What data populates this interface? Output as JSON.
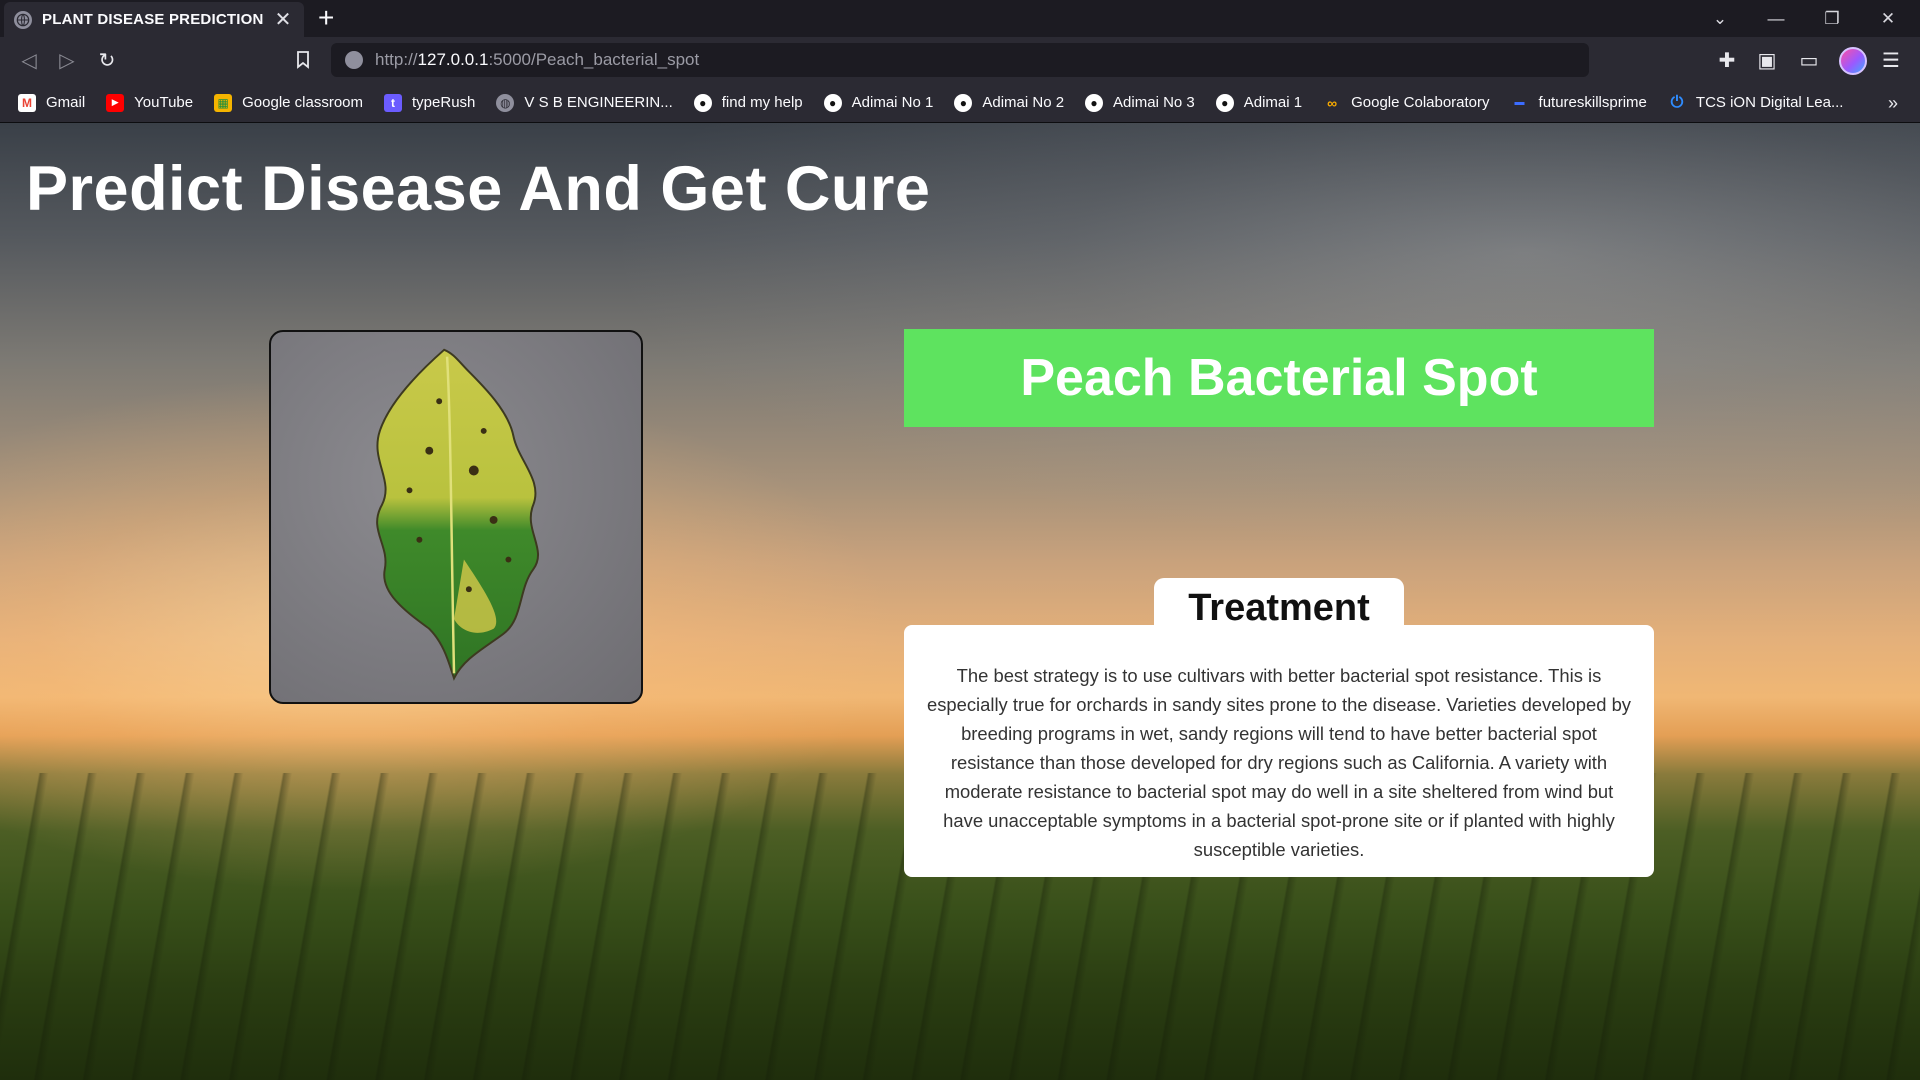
{
  "browser": {
    "tab_title": "PLANT DISEASE PREDICTION",
    "tab_close": "✕",
    "new_tab": "+",
    "url_scheme": "http://",
    "url_host": "127.0.0.1",
    "url_rest": ":5000/Peach_bacterial_spot",
    "bookmarks": [
      {
        "label": "Gmail",
        "icon": "gmail-icon"
      },
      {
        "label": "YouTube",
        "icon": "youtube-icon"
      },
      {
        "label": "Google classroom",
        "icon": "classroom-icon"
      },
      {
        "label": "typeRush",
        "icon": "typerush-icon"
      },
      {
        "label": "V S B ENGINEERIN...",
        "icon": "globe-icon"
      },
      {
        "label": "find my help",
        "icon": "github-icon"
      },
      {
        "label": "Adimai No 1",
        "icon": "github-icon"
      },
      {
        "label": "Adimai No 2",
        "icon": "github-icon"
      },
      {
        "label": "Adimai No 3",
        "icon": "github-icon"
      },
      {
        "label": "Adimai 1",
        "icon": "github-icon"
      },
      {
        "label": "Google Colaboratory",
        "icon": "colab-icon"
      },
      {
        "label": "futureskillsprime",
        "icon": "futureskills-icon"
      },
      {
        "label": "TCS iON Digital Lea...",
        "icon": "power-icon"
      }
    ],
    "bookmarks_more": "»"
  },
  "page": {
    "title": "Predict Disease And Get Cure",
    "disease": "Peach Bacterial Spot",
    "treatment_heading": "Treatment",
    "treatment_text": "The best strategy is to use cultivars with better bacterial spot resistance. This is especially true for orchards in sandy sites prone to the disease. Varieties developed by breeding programs in wet, sandy regions will tend to have better bacterial spot resistance than those developed for dry regions such as California. A variety with moderate resistance to bacterial spot may do well in a site sheltered from wind but have unacceptable symptoms in a bacterial spot-prone site or if planted with highly susceptible varieties."
  },
  "colors": {
    "banner": "#5ee35f",
    "chrome_dark": "#1c1b22",
    "chrome": "#2b2a33"
  }
}
